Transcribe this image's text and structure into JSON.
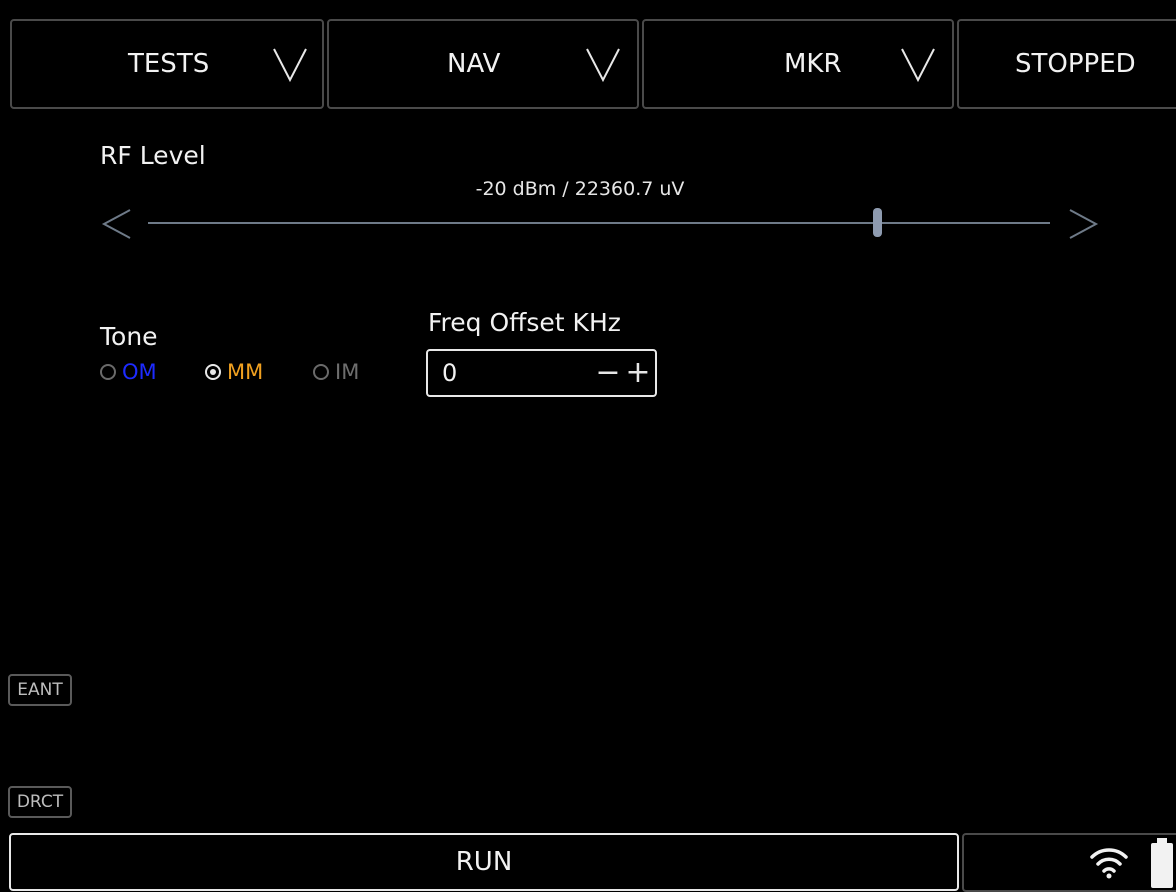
{
  "topbar": {
    "tests_label": "TESTS",
    "nav_label": "NAV",
    "mkr_label": "MKR",
    "status_label": "STOPPED"
  },
  "rf_level": {
    "label": "RF Level",
    "value_text": "-20 dBm / 22360.7 uV",
    "slider_fraction": 0.81
  },
  "tone": {
    "label": "Tone",
    "options": [
      {
        "label": "OM",
        "color": "#1d2bff",
        "selected": false
      },
      {
        "label": "MM",
        "color": "#f0a020",
        "selected": true
      },
      {
        "label": "IM",
        "color": "#6e6e6e",
        "selected": false
      }
    ]
  },
  "freq_offset": {
    "label": "Freq Offset KHz",
    "value": "0",
    "minus": "−",
    "plus": "+"
  },
  "side": {
    "eant_label": "EANT",
    "drct_label": "DRCT"
  },
  "bottombar": {
    "run_label": "RUN",
    "icons": [
      "wifi-icon",
      "battery-icon"
    ]
  },
  "colors": {
    "background": "#000000",
    "text": "#f2f2f2",
    "border": "#4a4a4a",
    "slider_track": "#6e7a88",
    "slider_thumb": "#8e9bb0"
  }
}
